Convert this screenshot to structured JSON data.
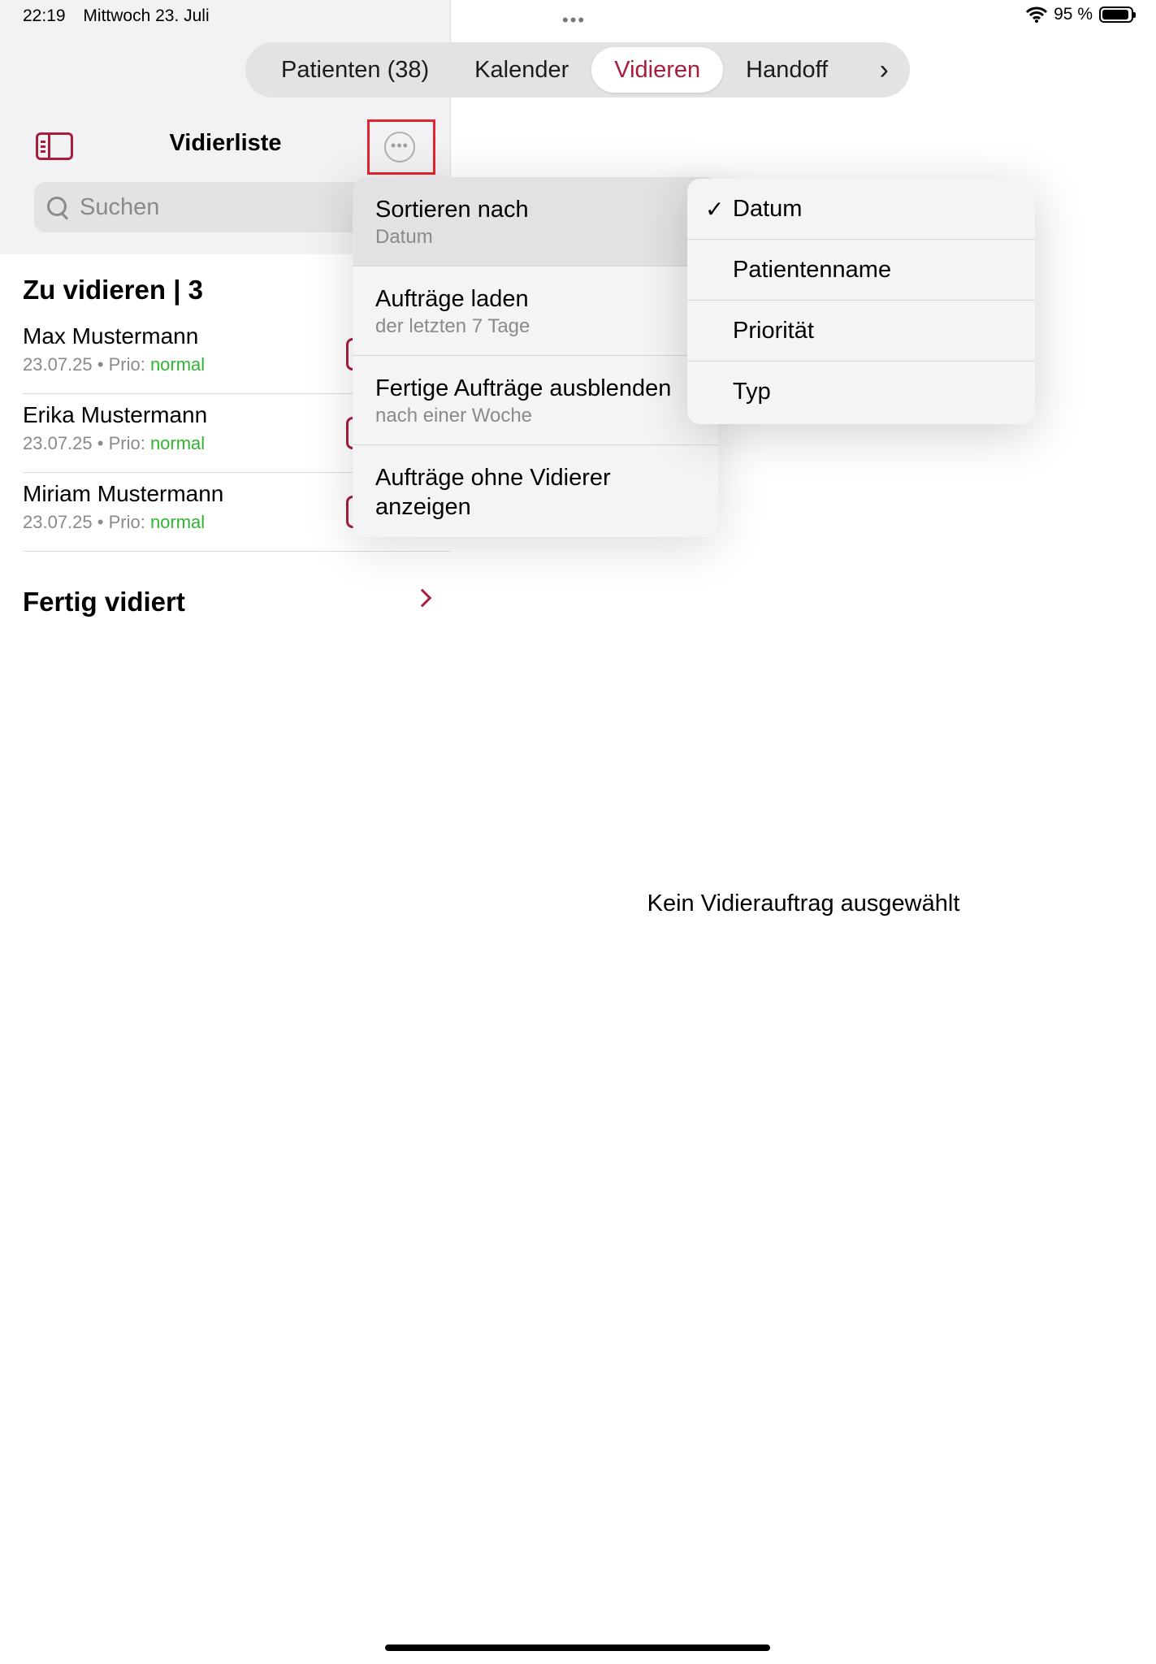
{
  "status_bar": {
    "time": "22:19",
    "date": "Mittwoch 23. Juli",
    "dots": "•••",
    "battery": "95 %",
    "battery_level": 0.95
  },
  "tabs": [
    {
      "label": "Patienten (38)",
      "active": false
    },
    {
      "label": "Kalender",
      "active": false
    },
    {
      "label": "Vidieren",
      "active": true
    },
    {
      "label": "Handoff",
      "active": false
    }
  ],
  "tabs_more": "›",
  "sidebar": {
    "title": "Vidierliste",
    "more_icon": "•••",
    "search_placeholder": "Suchen",
    "section_title": "Zu vidieren | 3",
    "items": [
      {
        "name": "Max Mustermann",
        "date": "23.07.25",
        "sep": " • ",
        "prio_label": "Prio: ",
        "prio_value": "normal"
      },
      {
        "name": "Erika Mustermann",
        "date": "23.07.25",
        "sep": " • ",
        "prio_label": "Prio: ",
        "prio_value": "normal"
      },
      {
        "name": "Miriam Mustermann",
        "date": "23.07.25",
        "sep": " • ",
        "prio_label": "Prio: ",
        "prio_value": "normal"
      }
    ],
    "done_title": "Fertig vidiert"
  },
  "detail": {
    "empty_text": "Kein Vidierauftrag ausgewählt"
  },
  "menu": {
    "items": [
      {
        "title": "Sortieren nach",
        "subtitle": "Datum"
      },
      {
        "title": "Aufträge laden",
        "subtitle": "der letzten 7 Tage"
      },
      {
        "title": "Fertige Aufträge ausblenden",
        "subtitle": "nach einer Woche"
      },
      {
        "title": "Aufträge ohne Vidierer anzeigen",
        "subtitle": ""
      }
    ]
  },
  "sort_menu": {
    "checkmark": "✓",
    "options": [
      {
        "label": "Datum",
        "selected": true
      },
      {
        "label": "Patientenname",
        "selected": false
      },
      {
        "label": "Priorität",
        "selected": false
      },
      {
        "label": "Typ",
        "selected": false
      }
    ]
  },
  "colors": {
    "accent": "#a61e3c",
    "prio_normal": "#2fb52f",
    "highlight_box": "#e0252f"
  }
}
